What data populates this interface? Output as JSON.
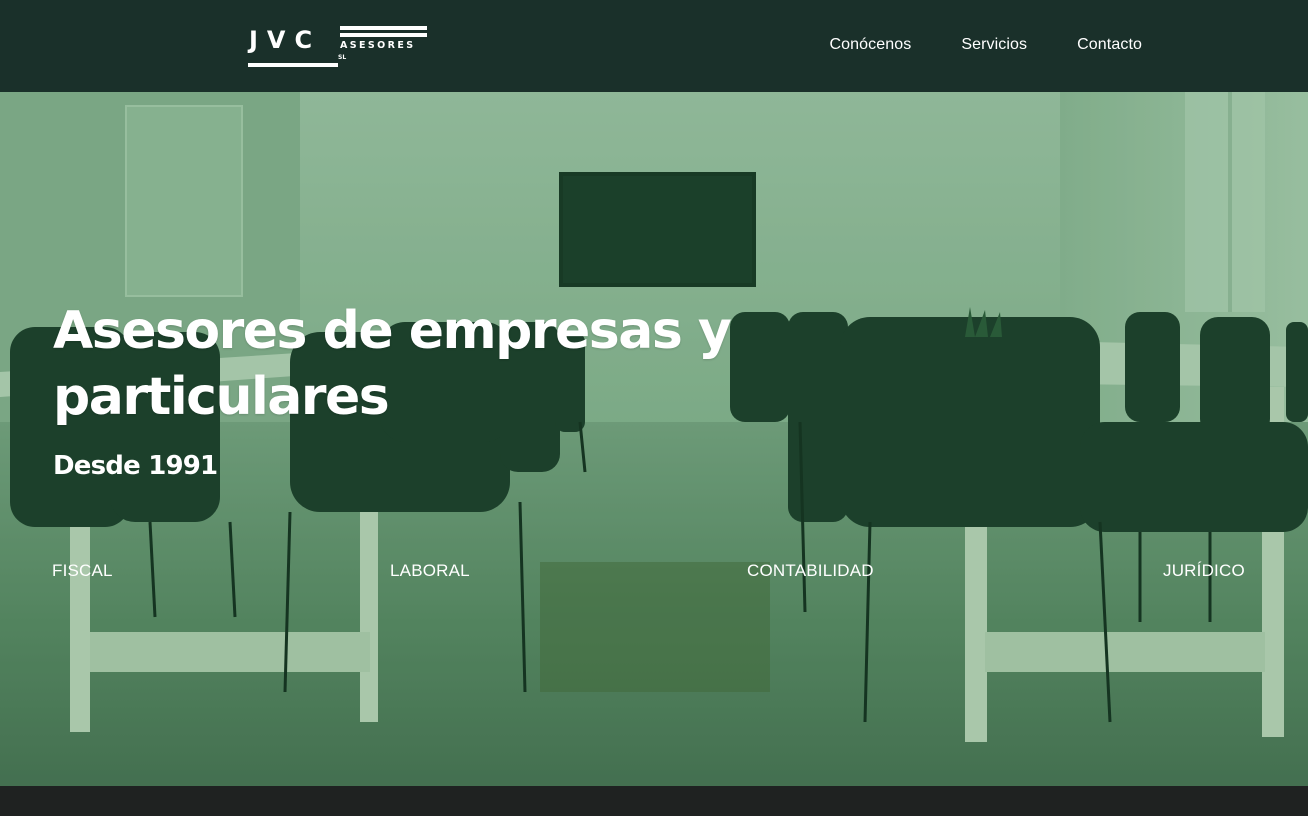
{
  "brand": {
    "name": "JVC",
    "subtitle": "ASESORES",
    "suffix": "SL"
  },
  "nav": {
    "items": [
      "Conócenos",
      "Servicios",
      "Contacto"
    ]
  },
  "hero": {
    "title": "Asesores de empresas y particulares",
    "subtitle": "Desde 1991",
    "services": [
      "FISCAL",
      "LABORAL",
      "CONTABILIDAD",
      "JURÍDICO"
    ]
  },
  "colors": {
    "header_bg": "#1a302a",
    "hero_tint": "#6f9a74",
    "footer_bg": "#1f2221",
    "text": "#ffffff"
  }
}
